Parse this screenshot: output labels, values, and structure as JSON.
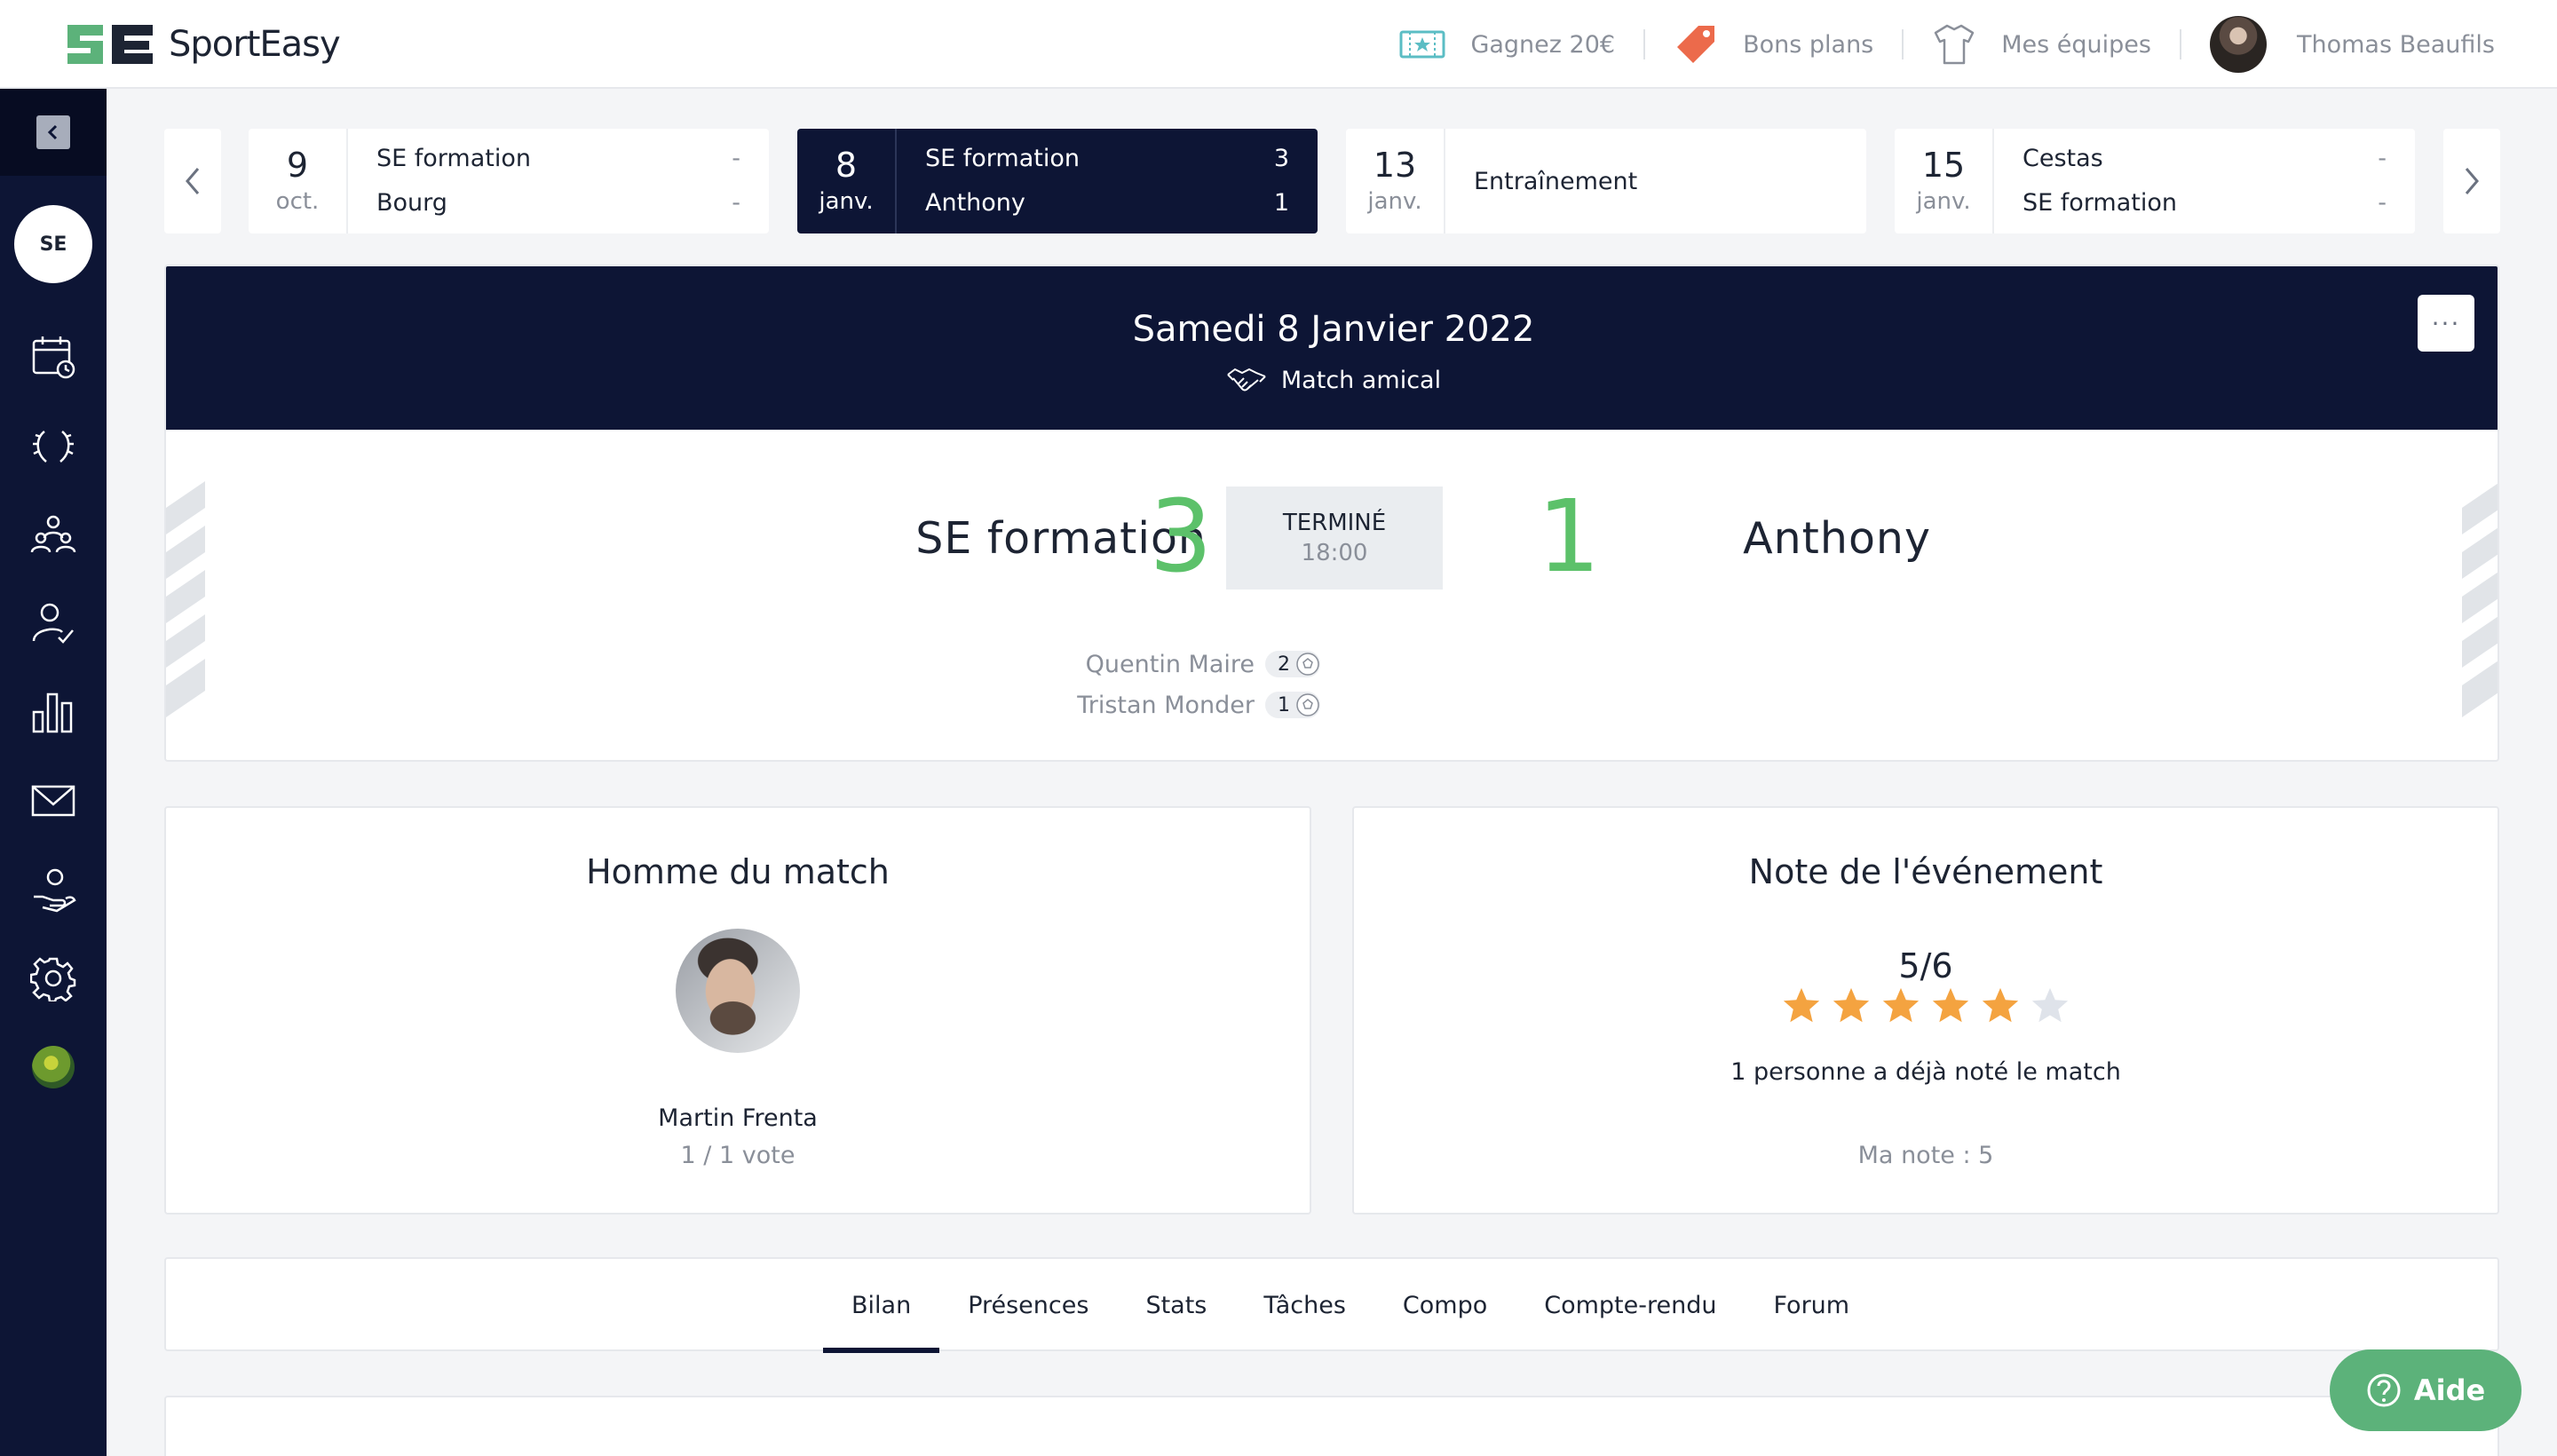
{
  "brand": {
    "name": "SportEasy",
    "mark": "SE"
  },
  "topnav": {
    "referral": "Gagnez 20€",
    "deals": "Bons plans",
    "teams": "Mes équipes",
    "user": "Thomas Beaufils"
  },
  "sidebar": {
    "team_badge": "SE",
    "icons": [
      "calendar-icon",
      "laurel-icon",
      "team-icon",
      "member-check-icon",
      "stats-icon",
      "mail-icon",
      "donate-icon",
      "settings-icon"
    ]
  },
  "events": [
    {
      "day": "9",
      "month": "oct.",
      "home": "SE formation",
      "home_score": "-",
      "away": "Bourg",
      "away_score": "-"
    },
    {
      "day": "8",
      "month": "janv.",
      "home": "SE formation",
      "home_score": "3",
      "away": "Anthony",
      "away_score": "1"
    },
    {
      "day": "13",
      "month": "janv.",
      "title": "Entraînement"
    },
    {
      "day": "15",
      "month": "janv.",
      "home": "Cestas",
      "home_score": "-",
      "away": "SE formation",
      "away_score": "-"
    }
  ],
  "match": {
    "date": "Samedi 8 Janvier 2022",
    "type": "Match amical",
    "more": "···",
    "home_team": "SE formation",
    "home_score": "3",
    "status": "TERMINÉ",
    "time": "18:00",
    "away_score": "1",
    "away_team": "Anthony",
    "scorers": [
      {
        "name": "Quentin Maire",
        "goals": "2"
      },
      {
        "name": "Tristan Monder",
        "goals": "1"
      }
    ]
  },
  "motm": {
    "title": "Homme du match",
    "name": "Martin Frenta",
    "votes": "1 / 1 vote"
  },
  "rating": {
    "title": "Note de l'événement",
    "value": "5/6",
    "filled": 5,
    "total": 6,
    "count_text": "1 personne a déjà noté le match",
    "my_note": "Ma note : 5"
  },
  "tabs": [
    "Bilan",
    "Présences",
    "Stats",
    "Tâches",
    "Compo",
    "Compte-rendu",
    "Forum"
  ],
  "help": "Aide",
  "colors": {
    "navy": "#0d1535",
    "score_green": "#5cc16a",
    "star": "#f4a340",
    "help_green": "#5cb27a"
  }
}
